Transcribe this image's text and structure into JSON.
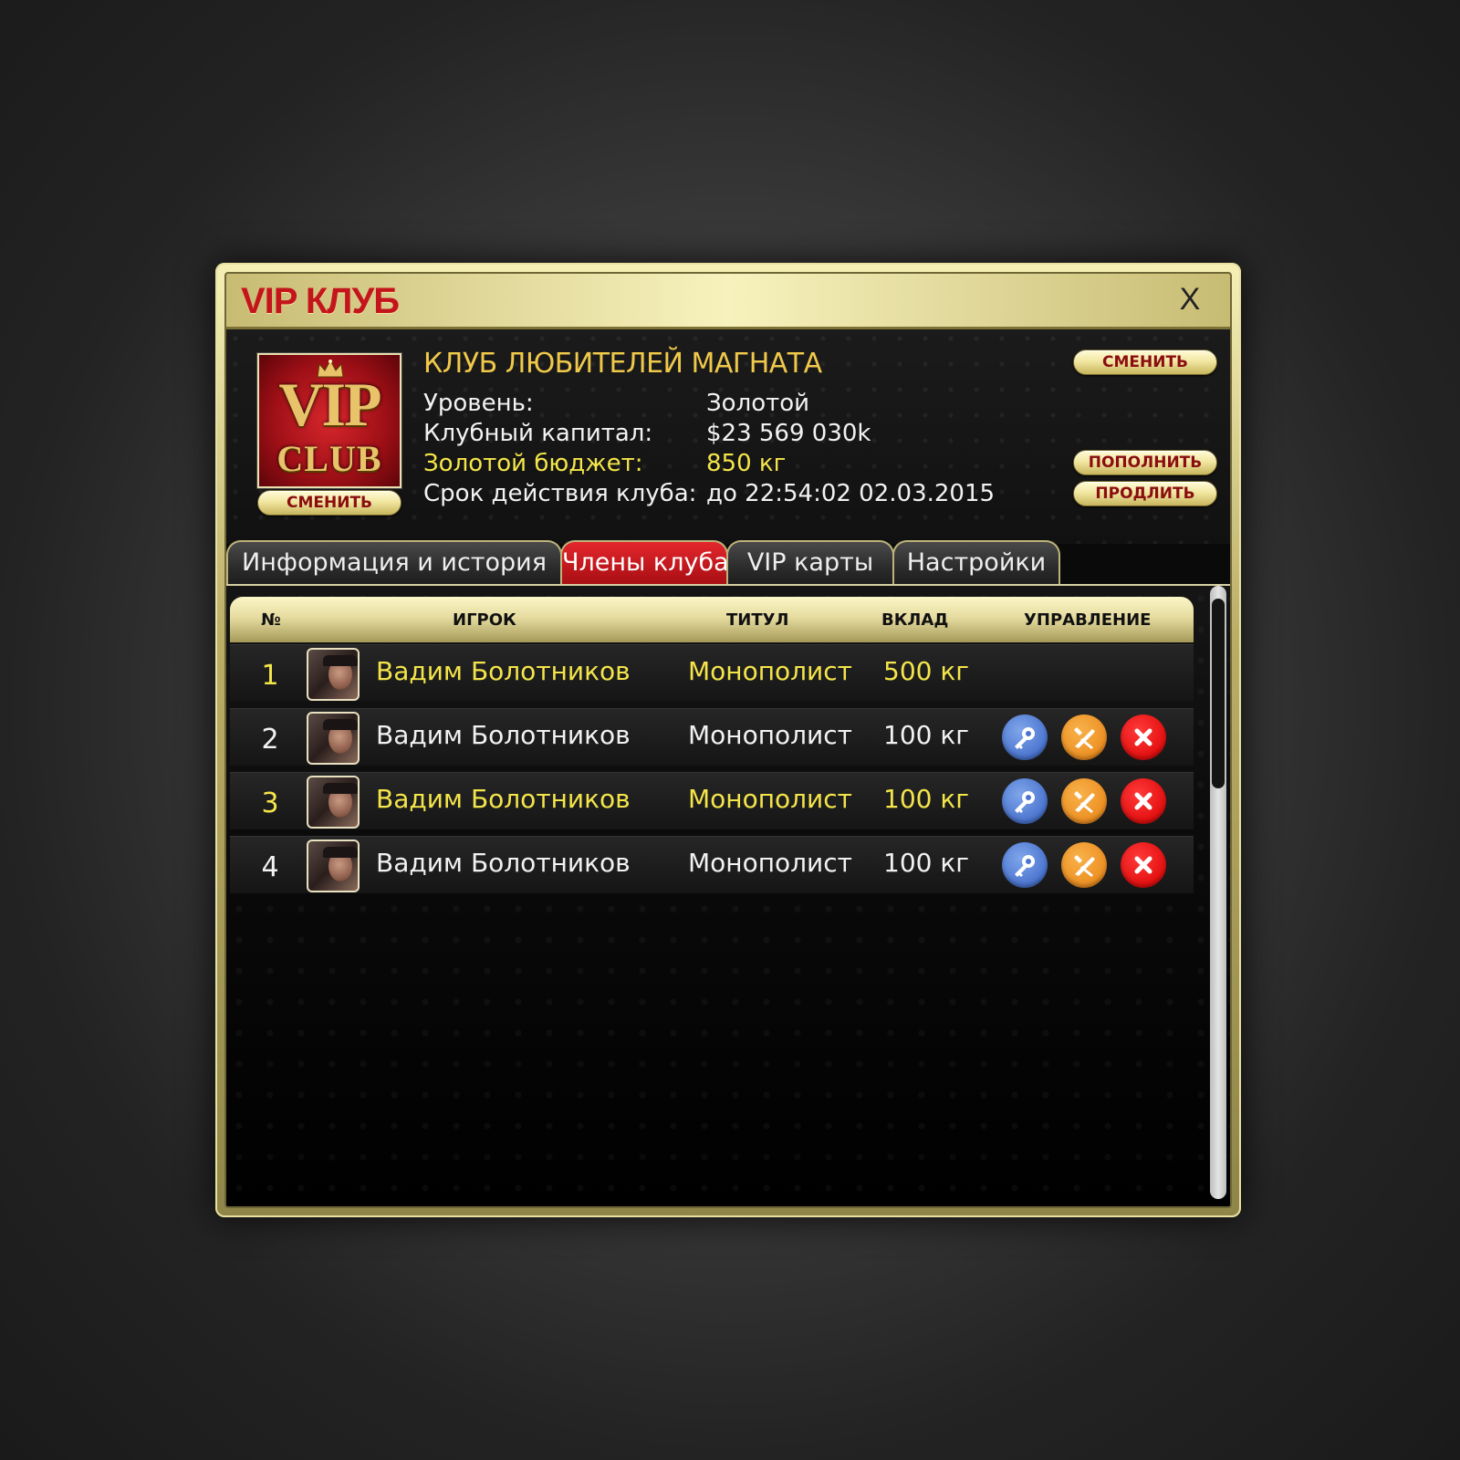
{
  "window": {
    "title": "VIP КЛУБ",
    "close_label": "X"
  },
  "logo": {
    "line1": "VIP",
    "line2": "CLUB",
    "change_label": "СМЕНИТЬ"
  },
  "club": {
    "name": "КЛУБ ЛЮБИТЕЛЕЙ МАГНАТА",
    "info": [
      {
        "label": "Уровень:",
        "value": "Золотой"
      },
      {
        "label": "Клубный капитал:",
        "value": "$23 569 030k"
      },
      {
        "label": "Золотой бюджет:",
        "value": "850 кг"
      },
      {
        "label": "Срок действия клуба:",
        "value": "до 22:54:02 02.03.2015"
      }
    ],
    "buttons": {
      "change": "СМЕНИТЬ",
      "topup": "ПОПОЛНИТЬ",
      "extend": "ПРОДЛИТЬ"
    }
  },
  "tabs": [
    {
      "label": "Информация и история",
      "active": false
    },
    {
      "label": "Члены клуба",
      "active": true
    },
    {
      "label": "VIP карты",
      "active": false
    },
    {
      "label": "Настройки",
      "active": false
    }
  ],
  "table": {
    "headers": {
      "num": "№",
      "player": "ИГРОК",
      "title": "ТИТУЛ",
      "contribution": "ВКЛАД",
      "actions": "УПРАВЛЕНИЕ"
    },
    "rows": [
      {
        "num": "1",
        "player": "Вадим Болотников",
        "title": "Монополист",
        "contribution": "500 кг",
        "highlight": true,
        "has_actions": false
      },
      {
        "num": "2",
        "player": "Вадим Болотников",
        "title": "Монополист",
        "contribution": "100 кг",
        "highlight": false,
        "has_actions": true
      },
      {
        "num": "3",
        "player": "Вадим Болотников",
        "title": "Монополист",
        "contribution": "100 кг",
        "highlight": true,
        "has_actions": true
      },
      {
        "num": "4",
        "player": "Вадим Болотников",
        "title": "Монополист",
        "contribution": "100 кг",
        "highlight": false,
        "has_actions": true
      }
    ],
    "action_icons": [
      "key-icon",
      "tools-icon",
      "delete-icon"
    ]
  },
  "colors": {
    "title_red": "#c4151c",
    "club_gold": "#f0c94a",
    "highlight_yellow": "#f4e54a",
    "text_white": "#f2f2f2",
    "active_tab_red": "#c41a1f",
    "key_blue": "#4a74cf",
    "tools_orange": "#ec8f22",
    "delete_red": "#e30f0f"
  }
}
